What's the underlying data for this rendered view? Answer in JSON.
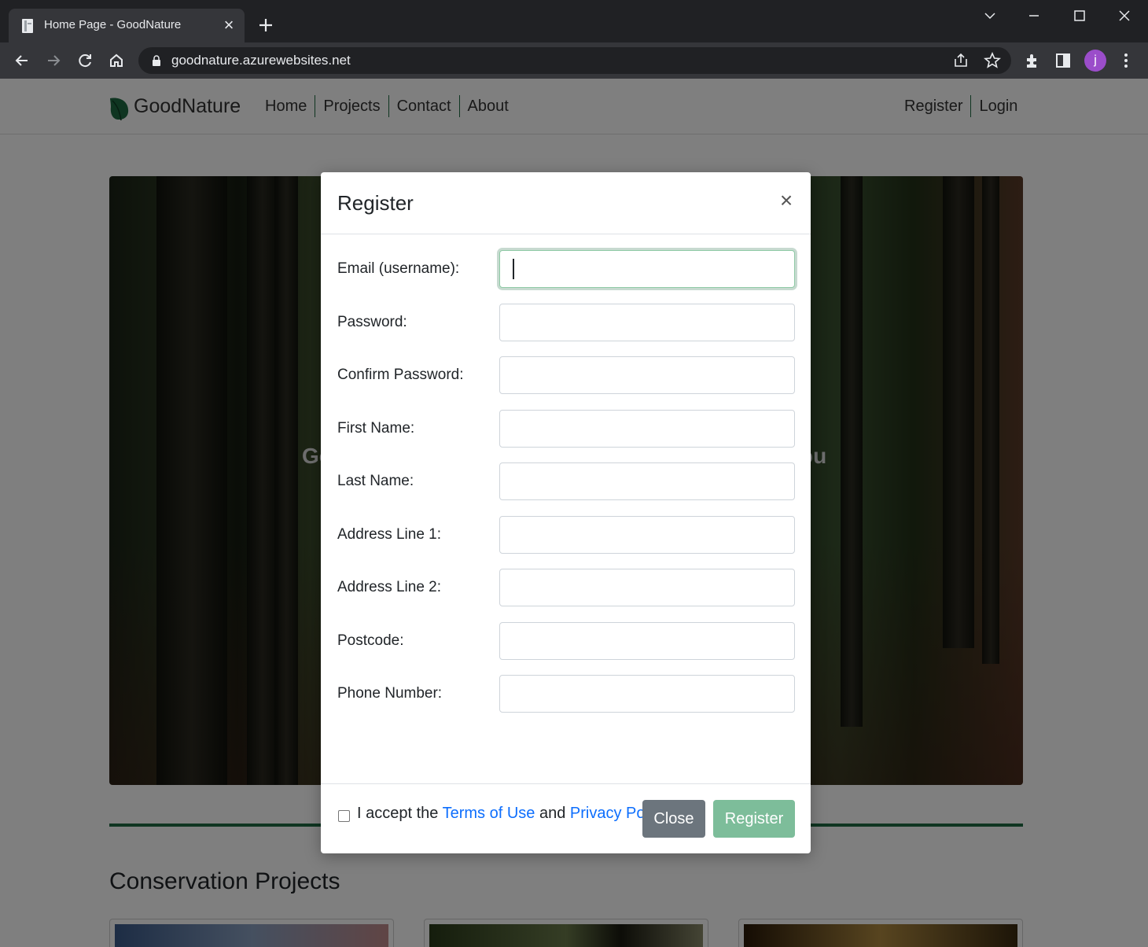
{
  "browser": {
    "tab_title": "Home Page - GoodNature",
    "url": "goodnature.azurewebsites.net",
    "profile_initial": "j"
  },
  "site": {
    "brand": "GoodNature",
    "nav": [
      "Home",
      "Projects",
      "Contact",
      "About"
    ],
    "nav_right": [
      "Register",
      "Login"
    ],
    "hero_left": "Go",
    "hero_right": "ou",
    "section_title": "Conservation Projects",
    "accent_color": "#1e6b42"
  },
  "modal": {
    "title": "Register",
    "fields": [
      {
        "label": "Email (username):",
        "value": ""
      },
      {
        "label": "Password:",
        "value": ""
      },
      {
        "label": "Confirm Password:",
        "value": ""
      },
      {
        "label": "First Name:",
        "value": ""
      },
      {
        "label": "Last Name:",
        "value": ""
      },
      {
        "label": "Address Line 1:",
        "value": ""
      },
      {
        "label": "Address Line 2:",
        "value": ""
      },
      {
        "label": "Postcode:",
        "value": ""
      },
      {
        "label": "Phone Number:",
        "value": ""
      }
    ],
    "terms_prefix": "I accept the",
    "terms_link": "Terms of Use",
    "terms_and": "and",
    "privacy_link": "Privacy Policy",
    "close_label": "Close",
    "register_label": "Register"
  }
}
